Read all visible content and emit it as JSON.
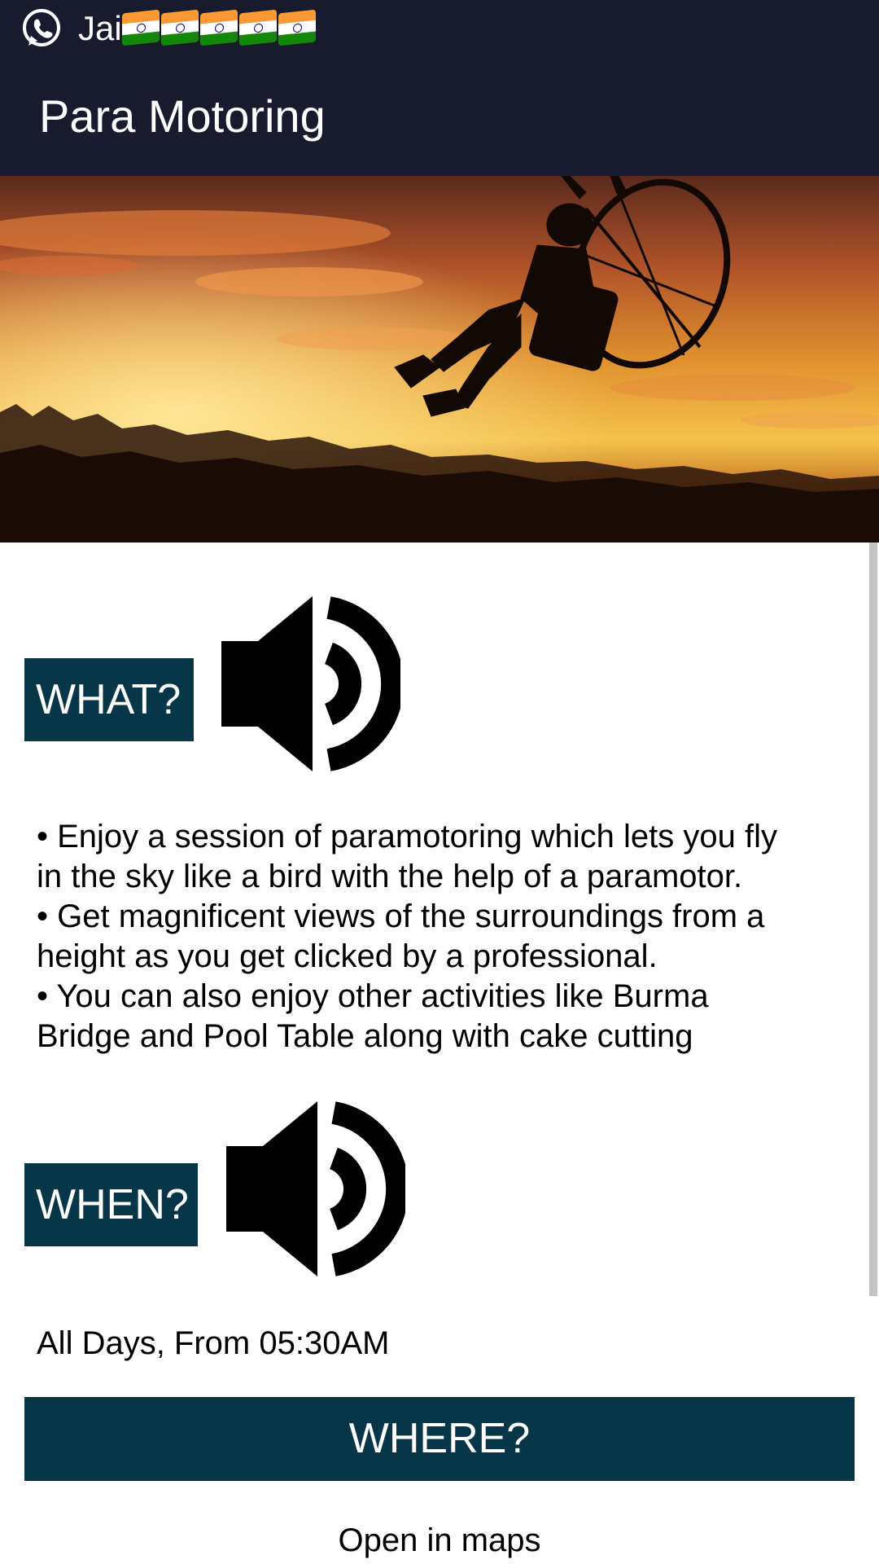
{
  "status_bar": {
    "notification_icon": "whatsapp-icon",
    "notification_text": "Jai",
    "emoji_flags": [
      "india-flag",
      "india-flag",
      "india-flag",
      "india-flag",
      "india-flag"
    ]
  },
  "app_bar": {
    "title": "Para Motoring",
    "background_color": "#181b2e"
  },
  "hero": {
    "image": "paramotor-sunset-photo"
  },
  "what_section": {
    "label": "WHAT?",
    "speaker_icon": "speaker-icon",
    "description_lines": [
      "• Enjoy a session of paramotoring which lets you fly",
      "in the sky like a bird with the help of a paramotor.",
      " • Get magnificent views of the surroundings from a",
      "height as you get clicked by a professional.",
      " • You can also enjoy other activities like Burma",
      "Bridge and Pool Table along with cake cutting"
    ]
  },
  "when_section": {
    "label": "WHEN?",
    "speaker_icon": "speaker-icon",
    "text": "All Days, From 05:30AM"
  },
  "where_section": {
    "label": "WHERE?",
    "maps_link": "Open in maps"
  },
  "colors": {
    "label_background": "#073649",
    "label_text": "#ffffff",
    "body_text": "#000000"
  }
}
